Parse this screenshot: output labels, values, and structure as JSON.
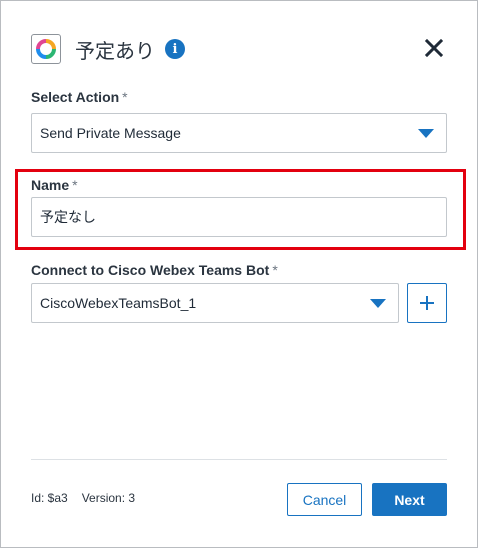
{
  "header": {
    "title": "予定あり",
    "info_icon": "info-icon",
    "app_icon": "colorful-ring-icon",
    "close_icon": "close-icon"
  },
  "select_action": {
    "label": "Select Action",
    "required_mark": "*",
    "value": "Send Private Message"
  },
  "name": {
    "label": "Name",
    "required_mark": "*",
    "value": "予定なし"
  },
  "connect": {
    "label": "Connect to Cisco Webex Teams Bot",
    "required_mark": "*",
    "value": "CiscoWebexTeamsBot_1",
    "add_icon": "plus-icon"
  },
  "footer": {
    "id_text": "Id: $a3",
    "version_text": "Version: 3",
    "cancel_label": "Cancel",
    "next_label": "Next"
  },
  "colors": {
    "accent": "#1873c1",
    "highlight": "#e3000f"
  }
}
